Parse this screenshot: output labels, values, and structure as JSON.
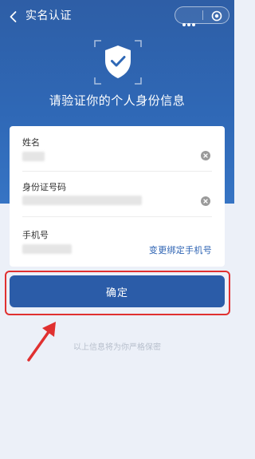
{
  "nav": {
    "title": "实名认证"
  },
  "hero": {
    "title": "请验证你的个人身份信息"
  },
  "form": {
    "fields": [
      {
        "label": "姓名"
      },
      {
        "label": "身份证号码"
      },
      {
        "label": "手机号"
      }
    ],
    "change_phone_link": "变更绑定手机号"
  },
  "actions": {
    "confirm_label": "确定"
  },
  "footer": {
    "privacy_note": "以上信息将为你严格保密"
  },
  "colors": {
    "primary": "#2b5ca8",
    "hero_top": "#2e5ea6",
    "highlight": "#e03030",
    "background": "#ecf0f8"
  }
}
